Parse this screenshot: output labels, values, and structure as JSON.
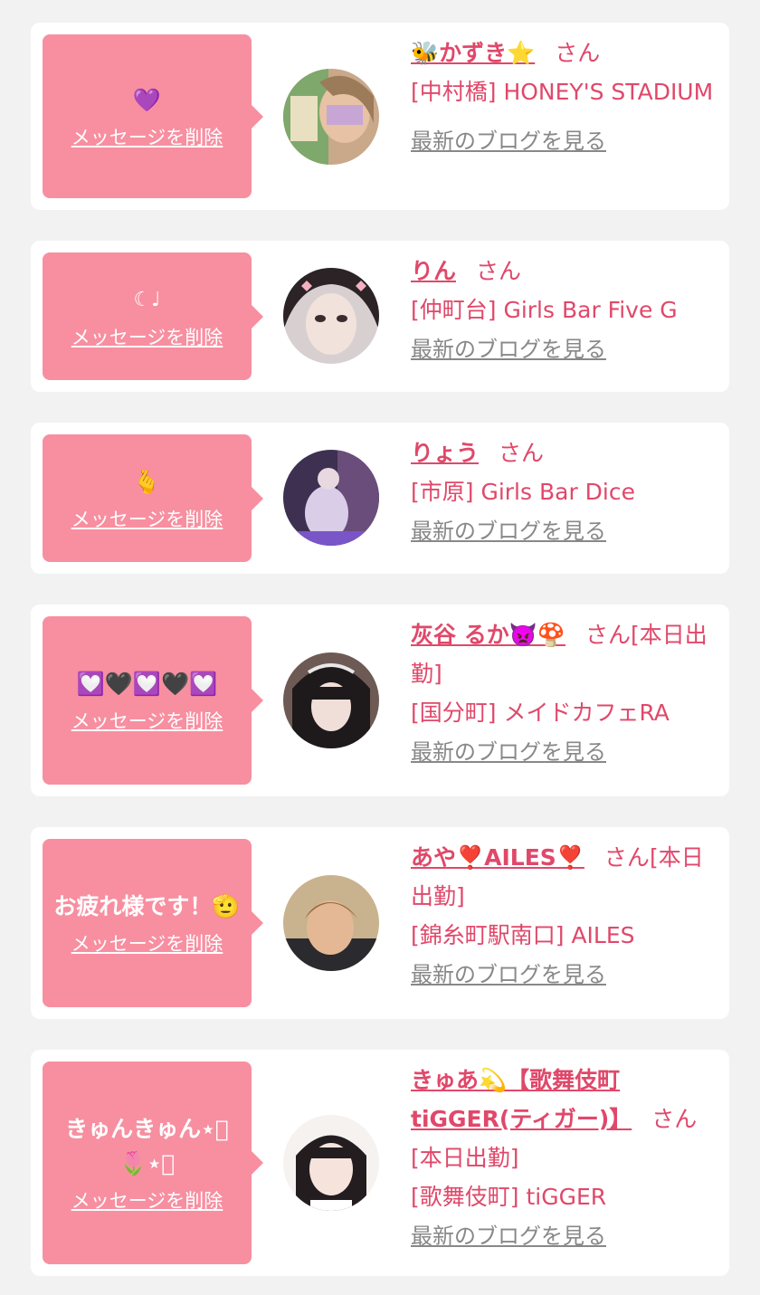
{
  "delete_label": "メッセージを削除",
  "blog_label": "最新のブログを見る",
  "san_label": "さん",
  "entries": [
    {
      "message": "💜",
      "name": "🐝かずき⭐",
      "suffix": "",
      "shop": "[中村橋] HONEY'S STADIUM"
    },
    {
      "message": "☾♩",
      "name": "りん",
      "suffix": "",
      "shop": "[仲町台] Girls Bar Five G"
    },
    {
      "message": "🫰",
      "name": "りょう",
      "suffix": "",
      "shop": "[市原] Girls Bar Dice"
    },
    {
      "message": "💟🖤💟🖤💟",
      "name": "灰谷 るか👿🍄",
      "suffix": "[本日出勤]",
      "shop": "[国分町] メイドカフェRA"
    },
    {
      "message": "お疲れ様です！🫡",
      "name": "あや❣️AILES❣️",
      "suffix": "[本日出勤]",
      "shop": "[錦糸町駅南口] AILES"
    },
    {
      "message": "きゅんきゅん⋆͛🌷⋆͛",
      "name": "きゅあ💫【歌舞伎町tiGGER(ティガー)】",
      "suffix": "[本日出勤]",
      "shop": "[歌舞伎町] tiGGER"
    }
  ],
  "colors": {
    "background": "#f2f2f2",
    "card": "#ffffff",
    "bubble": "#f78fa0",
    "accent": "#e0486a",
    "link_gray": "#888888"
  }
}
